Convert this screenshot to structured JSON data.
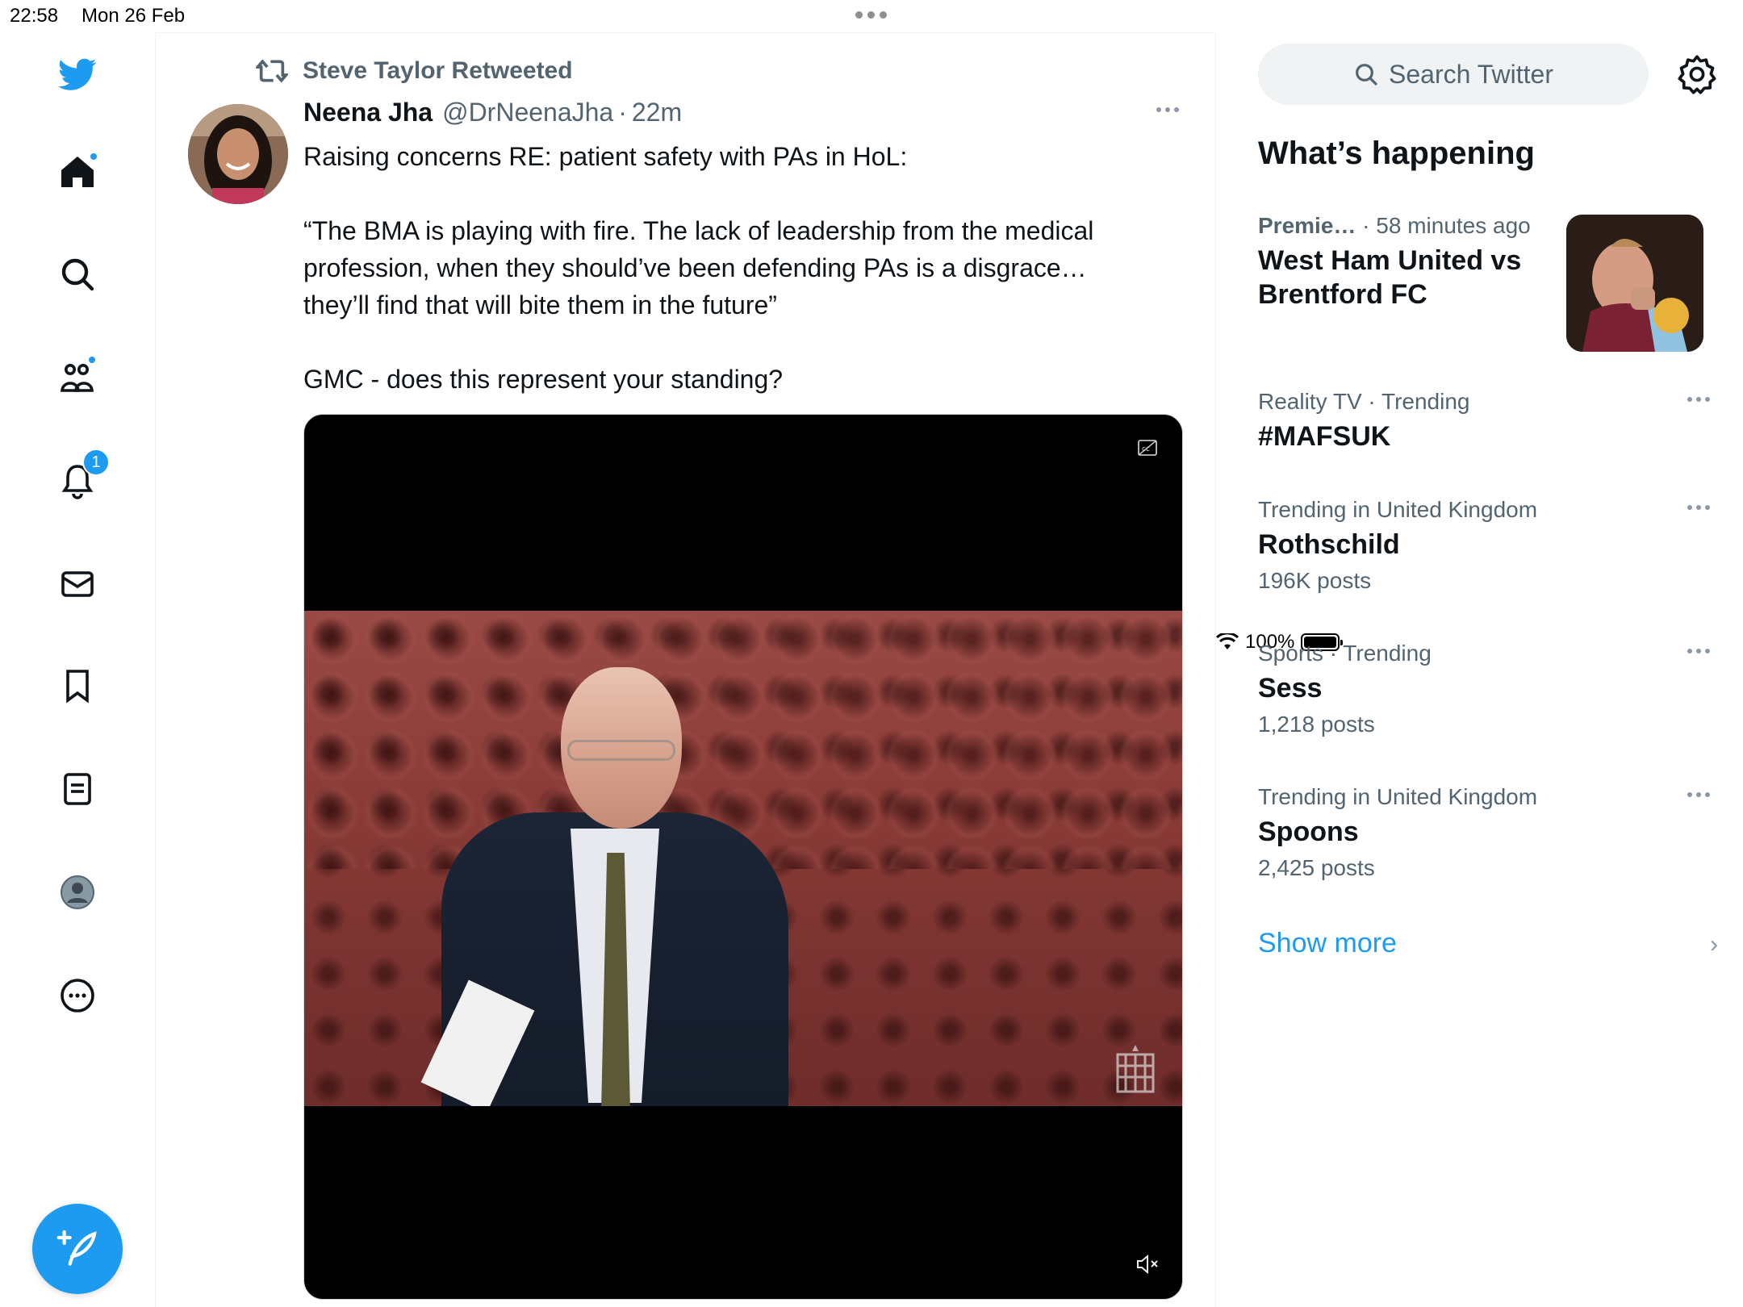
{
  "status_bar": {
    "time": "22:58",
    "date": "Mon 26 Feb",
    "battery": "100%"
  },
  "nav": {
    "notifications_badge": "1",
    "icons": [
      "twitter-logo-icon",
      "home-icon",
      "search-icon",
      "communities-icon",
      "notifications-icon",
      "messages-icon",
      "bookmarks-icon",
      "lists-icon",
      "profile-icon",
      "more-icon",
      "compose-icon"
    ]
  },
  "tweet": {
    "retweeted_by": "Steve Taylor Retweeted",
    "author_name": "Neena Jha",
    "author_handle": "@DrNeenaJha",
    "separator": "·",
    "time_ago": "22m",
    "text_lines": [
      "Raising concerns RE: patient safety with PAs in HoL:",
      "“The BMA is playing with fire. The lack of leadership from the medical",
      "profession, when they should’ve been defending PAs is a disgrace…",
      "they’ll find that will bite them in the future”",
      "GMC - does this represent your standing?"
    ]
  },
  "sidebar": {
    "search_placeholder": "Search Twitter",
    "section_title": "What’s happening",
    "trends": [
      {
        "meta": "Premie…",
        "meta_extra": " · 58 minutes ago",
        "title": "West Ham United vs Brentford FC",
        "count": ""
      },
      {
        "meta": "Reality TV · Trending",
        "title": "#MAFSUK",
        "count": ""
      },
      {
        "meta": "Trending in United Kingdom",
        "title": "Rothschild",
        "count": "196K posts"
      },
      {
        "meta": "Sports · Trending",
        "title": "Sess",
        "count": "1,218 posts"
      },
      {
        "meta": "Trending in United Kingdom",
        "title": "Spoons",
        "count": "2,425 posts"
      }
    ],
    "show_more": "Show more"
  },
  "colors": {
    "accent": "#1d9bf0",
    "text_primary": "#0f1419",
    "text_secondary": "#536471"
  }
}
